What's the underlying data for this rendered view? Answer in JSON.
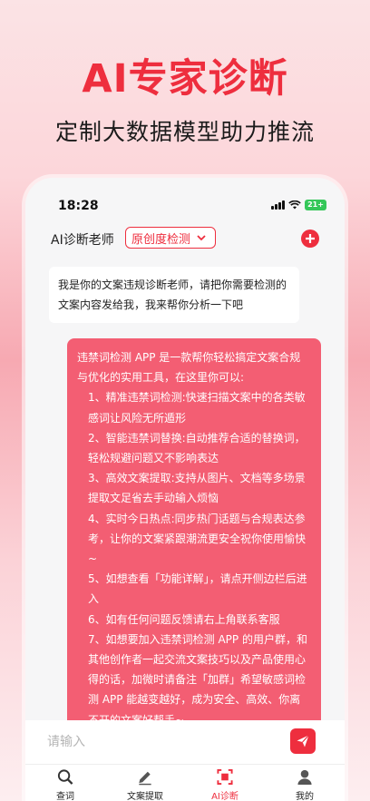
{
  "promo": {
    "headline": "AI专家诊断",
    "subline": "定制大数据模型助力推流"
  },
  "status_bar": {
    "time": "18:28",
    "battery": "21+"
  },
  "header": {
    "title": "AI诊断老师",
    "mode_label": "原创度检测"
  },
  "chat": {
    "teacher_message": "我是你的文案违规诊断老师，请把你需要检测的文案内容发给我，我来帮你分析一下吧",
    "user_message": [
      "违禁词检测 APP 是一款帮你轻松搞定文案合规与优化的实用工具，在这里你可以:",
      "1、精准违禁词检测:快速扫描文案中的各类敏感词让风险无所遁形",
      "2、智能违禁词替换:自动推荐合适的替换词，轻松规避问题又不影响表达",
      "3、高效文案提取:支持从图片、文档等多场景提取文足省去手动输入烦恼",
      "4、实时今日热点:同步热门话题与合规表达参考，让你的文案紧跟潮流更安全祝你使用愉快~",
      "5、如想查看「功能详解」，请点开侧边栏后进入",
      "6、如有任何问题反馈请右上角联系客服",
      "7、如想要加入违禁词检测 APP 的用户群，和其他创作者一起交流文案技巧以及产品使用心得的话，加微时请备注「加群」希望敏感词检测 APP 能越变越好，成为安全、高效、你离不开的文案好帮手~"
    ]
  },
  "input": {
    "placeholder": "请输入"
  },
  "tabs": [
    {
      "label": "查词",
      "icon": "search-icon",
      "active": false
    },
    {
      "label": "文案提取",
      "icon": "pencil-icon",
      "active": false
    },
    {
      "label": "AI诊断",
      "icon": "scan-icon",
      "active": true
    },
    {
      "label": "我的",
      "icon": "user-icon",
      "active": false
    }
  ],
  "colors": {
    "accent": "#ee2e3e",
    "user_bubble": "#f35e73",
    "phone_bg": "#f6f6f7"
  }
}
